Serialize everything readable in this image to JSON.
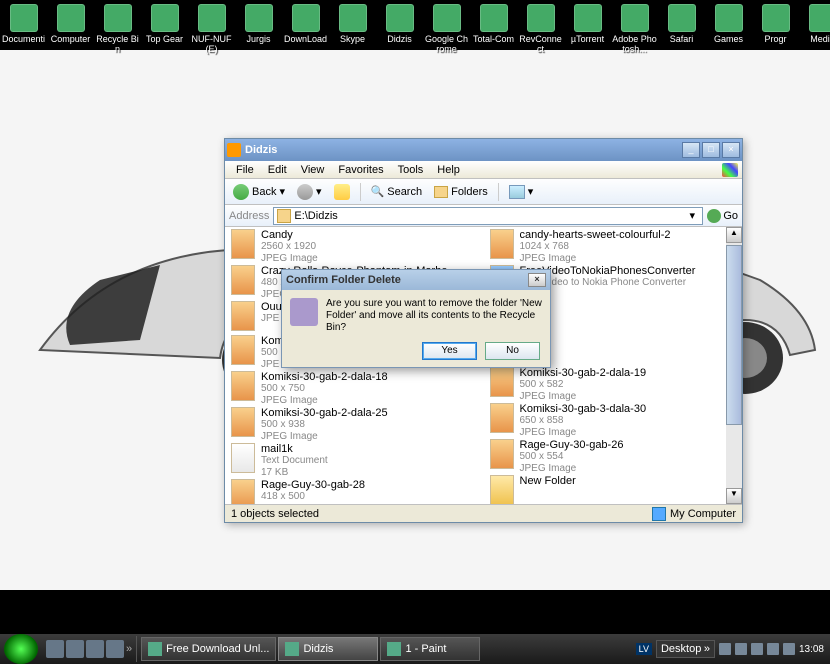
{
  "desktop": {
    "icons": [
      {
        "label": "Documenti",
        "ic": "ic-doc"
      },
      {
        "label": "Computer",
        "ic": "ic-comp"
      },
      {
        "label": "Recycle Bin",
        "ic": "ic-bin"
      },
      {
        "label": "Top Gear",
        "ic": "ic-gear"
      },
      {
        "label": "NUF-NUF (E)",
        "ic": "ic-nuf"
      },
      {
        "label": "Jurgis",
        "ic": "ic-app"
      },
      {
        "label": "DownLoad",
        "ic": "ic-dl"
      },
      {
        "label": "Skype",
        "ic": "ic-skype"
      },
      {
        "label": "Didzis",
        "ic": "ic-did"
      },
      {
        "label": "Google Chrome",
        "ic": "ic-chrome"
      },
      {
        "label": "Total-Com",
        "ic": "ic-cam"
      },
      {
        "label": "RevConnect",
        "ic": "ic-rev"
      },
      {
        "label": "µTorrent",
        "ic": "ic-ut"
      },
      {
        "label": "Adobe Photosh...",
        "ic": "ic-ps"
      },
      {
        "label": "Safari",
        "ic": "ic-safari"
      },
      {
        "label": "Games",
        "ic": "ic-games"
      },
      {
        "label": "Progr",
        "ic": "ic-progr"
      },
      {
        "label": "Media",
        "ic": "ic-media"
      }
    ]
  },
  "explorer": {
    "title": "Didzis",
    "menus": [
      "File",
      "Edit",
      "View",
      "Favorites",
      "Tools",
      "Help"
    ],
    "toolbar": {
      "back": "Back",
      "search": "Search",
      "folders": "Folders"
    },
    "address": {
      "label": "Address",
      "path": "E:\\Didzis",
      "go": "Go"
    },
    "files_left": [
      {
        "name": "Candy",
        "meta1": "2560 x 1920",
        "meta2": "JPEG Image",
        "ic": "fjpg"
      },
      {
        "name": "Crazy-Rolls-Royce-Phantom-in-Marbe...",
        "meta1": "480 x 320",
        "meta2": "JPEG Image",
        "ic": "fjpg"
      },
      {
        "name": "Ouu",
        "meta1": "",
        "meta2": "JPE",
        "ic": "fjpg"
      },
      {
        "name": "Komi",
        "meta1": "500",
        "meta2": "JPE",
        "ic": "fjpg"
      },
      {
        "name": "Komiksi-30-gab-2-dala-18",
        "meta1": "500 x 750",
        "meta2": "JPEG Image",
        "ic": "fjpg"
      },
      {
        "name": "Komiksi-30-gab-2-dala-25",
        "meta1": "500 x 938",
        "meta2": "JPEG Image",
        "ic": "fjpg"
      },
      {
        "name": "mail1k",
        "meta1": "Text Document",
        "meta2": "17 KB",
        "ic": "ftxt"
      },
      {
        "name": "Rage-Guy-30-gab-28",
        "meta1": "418 x 500",
        "meta2": "JPEG Image",
        "ic": "fjpg"
      }
    ],
    "files_right": [
      {
        "name": "candy-hearts-sweet-colourful-2",
        "meta1": "1024 x 768",
        "meta2": "JPEG Image",
        "ic": "fjpg"
      },
      {
        "name": "FreeVideoToNokiaPhonesConverter",
        "meta1": "Free Video to Nokia Phone Converter",
        "meta2": "",
        "ic": "fexe"
      },
      {
        "name": "",
        "meta1": "",
        "meta2": "",
        "ic": ""
      },
      {
        "name": "",
        "meta1": "",
        "meta2": "",
        "ic": ""
      },
      {
        "name": "Komiksi-30-gab-2-dala-19",
        "meta1": "500 x 582",
        "meta2": "JPEG Image",
        "ic": "fjpg"
      },
      {
        "name": "Komiksi-30-gab-3-dala-30",
        "meta1": "650 x 858",
        "meta2": "JPEG Image",
        "ic": "fjpg"
      },
      {
        "name": "Rage-Guy-30-gab-26",
        "meta1": "500 x 554",
        "meta2": "JPEG Image",
        "ic": "fjpg"
      },
      {
        "name": "New Folder",
        "meta1": "",
        "meta2": "",
        "ic": "ffolder"
      }
    ],
    "status": {
      "left": "1 objects selected",
      "right": "My Computer"
    }
  },
  "dialog": {
    "title": "Confirm Folder Delete",
    "message": "Are you sure you want to remove the folder 'New Folder' and move all its contents to the Recycle Bin?",
    "yes": "Yes",
    "no": "No"
  },
  "taskbar": {
    "tasks": [
      {
        "label": "Free Download Unl...",
        "active": false
      },
      {
        "label": "Didzis",
        "active": true
      },
      {
        "label": "1 - Paint",
        "active": false
      }
    ],
    "lang": "LV",
    "desk_label": "Desktop",
    "clock": "13:08"
  }
}
